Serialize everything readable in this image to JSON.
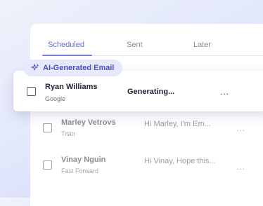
{
  "tabs": [
    {
      "label": "Scheduled",
      "active": true
    },
    {
      "label": "Sent",
      "active": false
    },
    {
      "label": "Later",
      "active": false
    }
  ],
  "ai_badge": {
    "label": "AI-Generated Email",
    "icon": "sparkles-icon"
  },
  "highlighted_row": {
    "name": "Ryan Williams",
    "company": "Google",
    "status": "Generating...",
    "more": "..."
  },
  "rows": [
    {
      "name": "Marley Vetrovs",
      "company": "Titan",
      "preview": "Hi Marley, I'm Em...",
      "more": "..."
    },
    {
      "name": "Vinay Nguin",
      "company": "Fast Forward",
      "preview": "Hi Vinay, Hope this...",
      "more": "..."
    }
  ],
  "colors": {
    "accent": "#6b6dd6",
    "pill_bg": "#e6e8fb",
    "pill_text": "#4f4fbf"
  }
}
